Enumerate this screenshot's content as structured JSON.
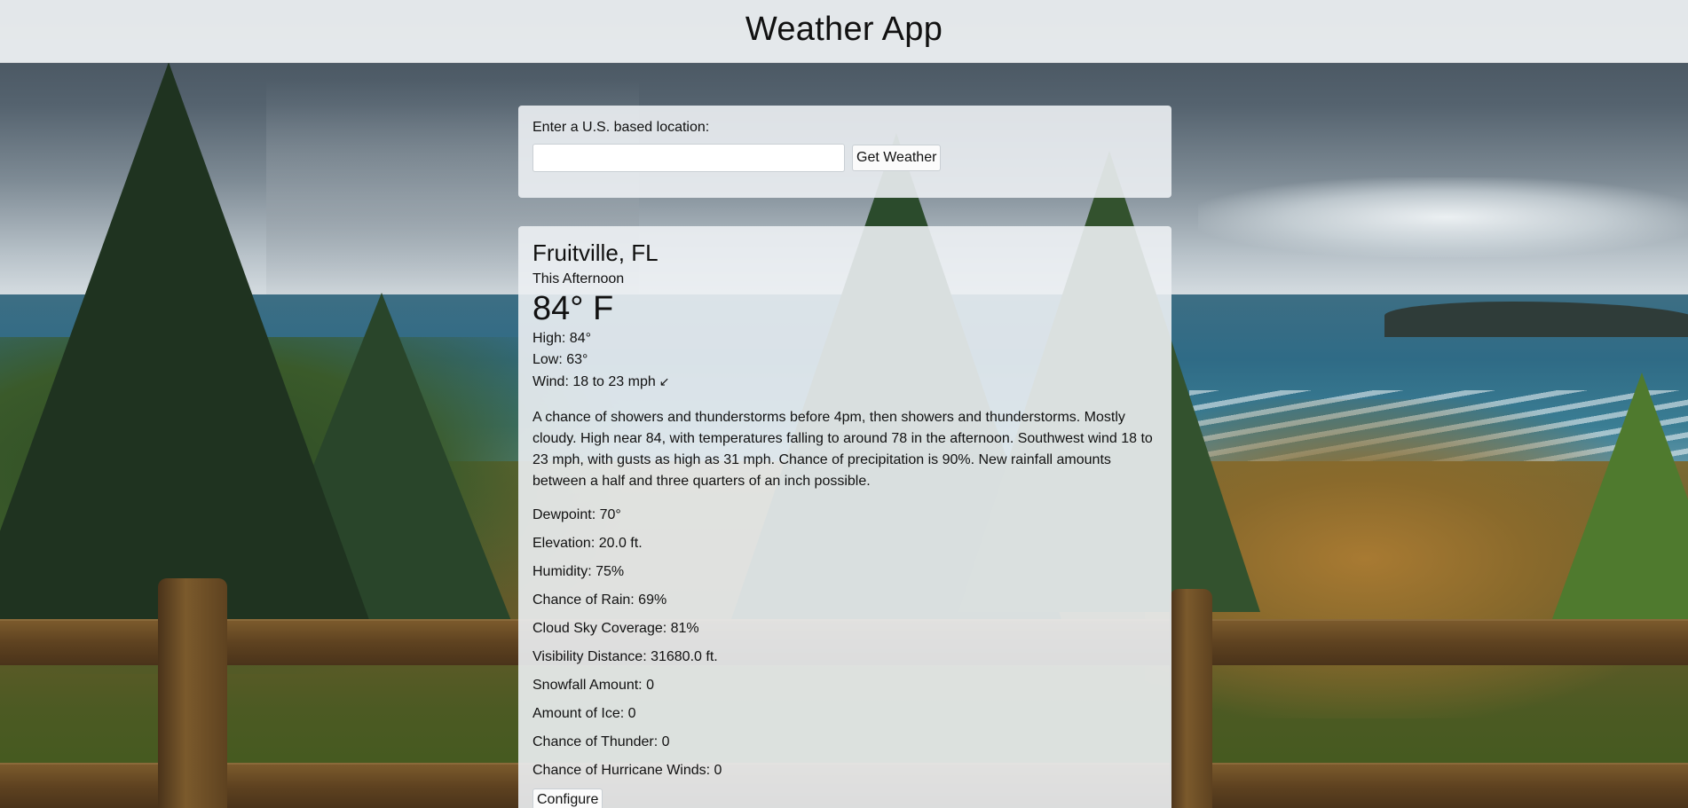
{
  "header": {
    "title": "Weather App"
  },
  "search": {
    "label": "Enter a U.S. based location:",
    "input_value": "",
    "input_placeholder": "",
    "button_label": "Get Weather"
  },
  "weather": {
    "location": "Fruitville, FL",
    "period": "This Afternoon",
    "temperature": "84° F",
    "high": "High: 84°",
    "low": "Low: 63°",
    "wind": "Wind: 18 to 23 mph",
    "wind_direction_glyph": "↙",
    "forecast": "A chance of showers and thunderstorms before 4pm, then showers and thunderstorms. Mostly cloudy. High near 84, with temperatures falling to around 78 in the afternoon. Southwest wind 18 to 23 mph, with gusts as high as 31 mph. Chance of precipitation is 90%. New rainfall amounts between a half and three quarters of an inch possible.",
    "details": [
      "Dewpoint: 70°",
      "Elevation: 20.0 ft.",
      "Humidity: 75%",
      "Chance of Rain: 69%",
      "Cloud Sky Coverage: 81%",
      "Visibility Distance: 31680.0 ft.",
      "Snowfall Amount: 0",
      "Amount of Ice: 0",
      "Chance of Thunder: 0",
      "Chance of Hurricane Winds: 0"
    ],
    "configure_label": "Configure"
  }
}
